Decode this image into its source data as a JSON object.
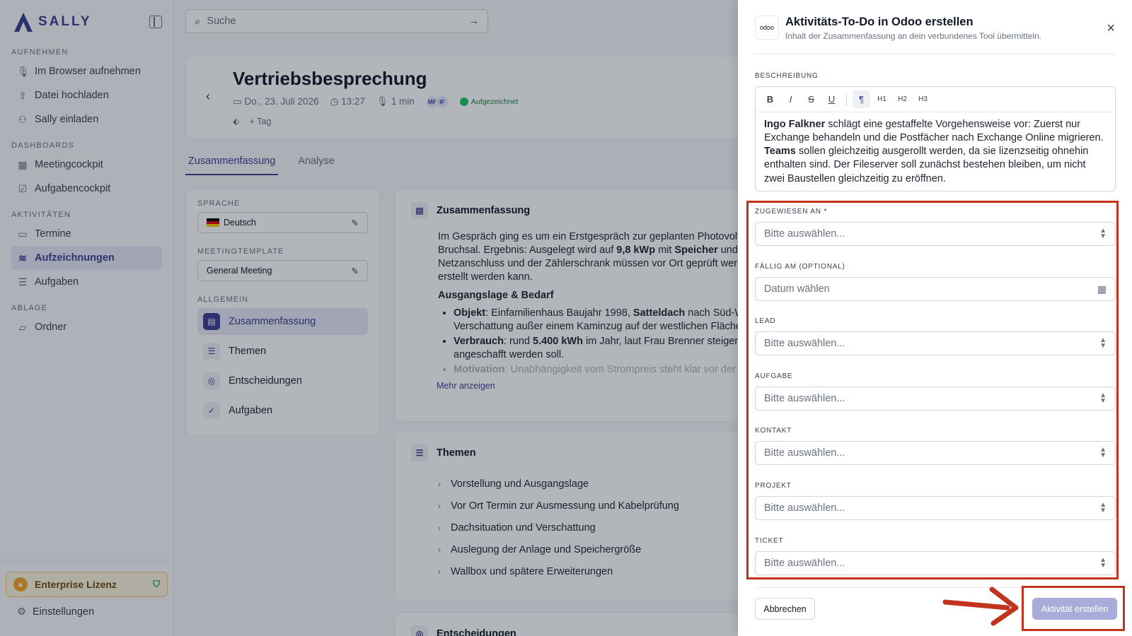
{
  "sidebar": {
    "logo_text": "SALLY",
    "sections": [
      {
        "label": "AUFNEHMEN",
        "items": [
          {
            "icon": "mic-icon",
            "label": "Im Browser aufnehmen"
          },
          {
            "icon": "upload-icon",
            "label": "Datei hochladen"
          },
          {
            "icon": "user-plus-icon",
            "label": "Sally einladen"
          }
        ]
      },
      {
        "label": "DASHBOARDS",
        "items": [
          {
            "icon": "grid-icon",
            "label": "Meetingcockpit"
          },
          {
            "icon": "checklist-icon",
            "label": "Aufgabencockpit"
          }
        ]
      },
      {
        "label": "AKTIVITÄTEN",
        "items": [
          {
            "icon": "calendar-icon",
            "label": "Termine"
          },
          {
            "icon": "waveform-icon",
            "label": "Aufzeichnungen"
          },
          {
            "icon": "list-check-icon",
            "label": "Aufgaben"
          }
        ]
      },
      {
        "label": "ABLAGE",
        "items": [
          {
            "icon": "folder-icon",
            "label": "Ordner"
          }
        ]
      }
    ],
    "license": "Enterprise Lizenz",
    "settings": "Einstellungen"
  },
  "search": {
    "placeholder": "Suche"
  },
  "meeting": {
    "title": "Vertriebsbesprechung",
    "date": "Do., 23. Juli 2026",
    "time": "13:27",
    "duration": "1 min",
    "avatars": [
      "MF",
      "IF"
    ],
    "status": "Aufgezeichnet",
    "tag_button": "Tag"
  },
  "tabs": [
    "Zusammenfassung",
    "Analyse"
  ],
  "left_panel": {
    "language_label": "SPRACHE",
    "language": "Deutsch",
    "template_label": "MEETINGTEMPLATE",
    "template": "General Meeting",
    "general_label": "ALLGEMEIN",
    "nav": [
      "Zusammenfassung",
      "Themen",
      "Entscheidungen",
      "Aufgaben"
    ]
  },
  "summary": {
    "heading": "Zusammenfassung",
    "intro_1": "Im Gespräch ging es um ein Erstgespräch zur geplanten Photovoltaik",
    "intro_2a": "Bruchsal. Ergebnis: Ausgelegt wird auf ",
    "intro_2b": "9,8 kWp",
    "intro_2c": " mit ",
    "intro_2d": "Speicher",
    "intro_2e": " und Vo",
    "intro_3": "Netzanschluss und der Zählerschrank müssen vor Ort geprüft werde",
    "intro_4": "erstellt werden kann.",
    "sub_heading": "Ausgangslage & Bedarf",
    "b1_label": "Objekt",
    "b1_text_a": ": Einfamilienhaus Baujahr 1998, ",
    "b1_bold": "Satteldach",
    "b1_text_b": " nach Süd-Wes",
    "b1_line2": "Verschattung außer einem Kaminzug auf der westlichen Fläche (",
    "b2_label": "Verbrauch",
    "b2_text_a": ": rund ",
    "b2_bold": "5.400 kWh",
    "b2_text_b": " im Jahr, laut Frau Brenner steigend, ",
    "b2_line2": "angeschafft werden soll.",
    "b3_label": "Motivation",
    "b3_text": ": Unabhängigkeit vom Strompreis steht klar vor der re",
    "more": "Mehr anzeigen"
  },
  "themes": {
    "heading": "Themen",
    "items": [
      "Vorstellung und Ausgangslage",
      "Vor Ort Termin zur Ausmessung und Kabelprüfung",
      "Dachsituation und Verschattung",
      "Auslegung der Anlage und Speichergröße",
      "Wallbox und spätere Erweiterungen"
    ]
  },
  "decisions": {
    "heading": "Entscheidungen"
  },
  "drawer": {
    "logo": "odoo",
    "title": "Aktivitäts-To-Do in Odoo erstellen",
    "subtitle": "Inhalt der Zusammenfassung an dein verbundenes Tool übermitteln.",
    "description_label": "BESCHREIBUNG",
    "toolbar": [
      "B",
      "I",
      "S",
      "U",
      "¶",
      "H1",
      "H2",
      "H3"
    ],
    "description": {
      "name_1": "Ingo Falkner",
      "text_1": " schlägt eine gestaffelte Vorgehensweise vor: Zuerst nur Exchange behandeln und die Postfächer nach Exchange Online migrieren. ",
      "name_2": "Teams",
      "text_2": " sollen gleichzeitig ausgerollt werden, da sie lizenzseitig ohnehin enthalten sind. Der Fileserver soll zunächst bestehen bleiben, um nicht zwei Baustellen gleichzeitig zu eröffnen."
    },
    "fields": [
      {
        "label": "ZUGEWIESEN AN *",
        "placeholder": "Bitte auswählen..."
      },
      {
        "label": "FÄLLIG AM (OPTIONAL)",
        "placeholder": "Datum wählen"
      },
      {
        "label": "LEAD",
        "placeholder": "Bitte auswählen..."
      },
      {
        "label": "AUFGABE",
        "placeholder": "Bitte auswählen..."
      },
      {
        "label": "KONTAKT",
        "placeholder": "Bitte auswählen..."
      },
      {
        "label": "PROJEKT",
        "placeholder": "Bitte auswählen..."
      },
      {
        "label": "TICKET",
        "placeholder": "Bitte auswählen..."
      }
    ],
    "cancel": "Abbrechen",
    "create": "Aktivität erstellen"
  },
  "colors": {
    "accent": "#3b3f8f",
    "annotation": "#c2331e",
    "create_button": "#a9acd8"
  }
}
